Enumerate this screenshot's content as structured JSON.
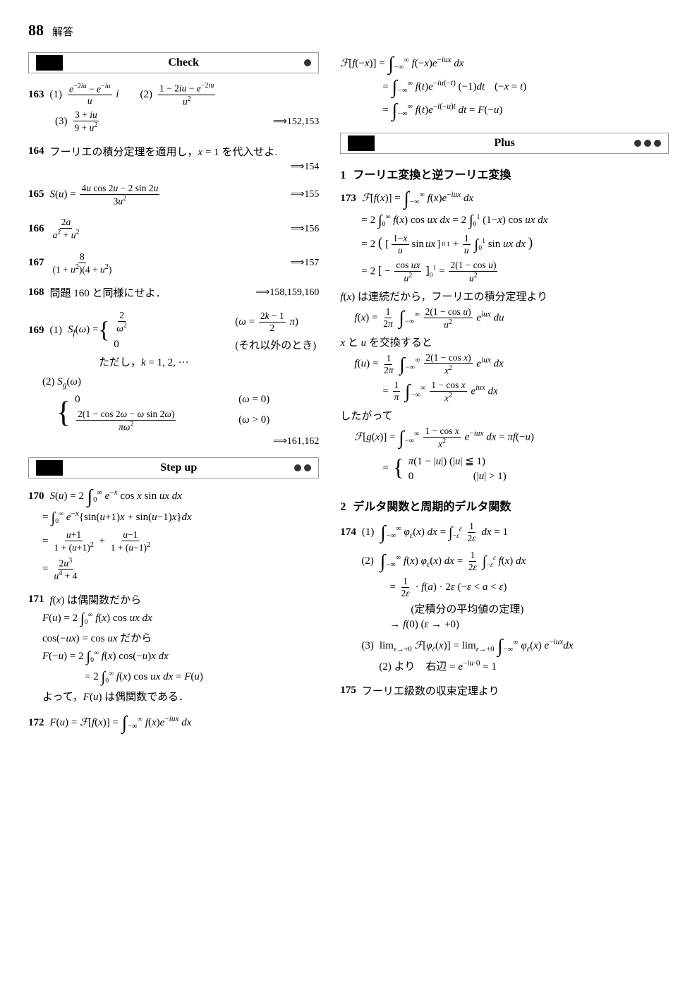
{
  "page": {
    "number": "88",
    "label": "解答"
  },
  "sections": {
    "check": {
      "title": "Check",
      "dots": 1
    },
    "stepup": {
      "title": "Step up",
      "dots": 2
    },
    "plus": {
      "title": "Plus",
      "dots": 3
    }
  },
  "numbered_sections": {
    "sec1": {
      "num": "1",
      "title": "フーリエ変換と逆フーリエ変換"
    },
    "sec2": {
      "num": "2",
      "title": "デルタ関数と周期的デルタ関数"
    }
  },
  "problems": {
    "p163": "163",
    "p164": "164",
    "p165": "165",
    "p166": "166",
    "p167": "167",
    "p168": "168",
    "p169": "169",
    "p170": "170",
    "p171": "171",
    "p172": "172",
    "p173": "173",
    "p174": "174",
    "p175": "175"
  },
  "refs": {
    "r152153": "⟹152,153",
    "r154": "⟹154",
    "r155": "⟹155",
    "r156": "⟹156",
    "r157": "⟹157",
    "r158": "⟹158,159,160",
    "r161162": "⟹161,162"
  }
}
